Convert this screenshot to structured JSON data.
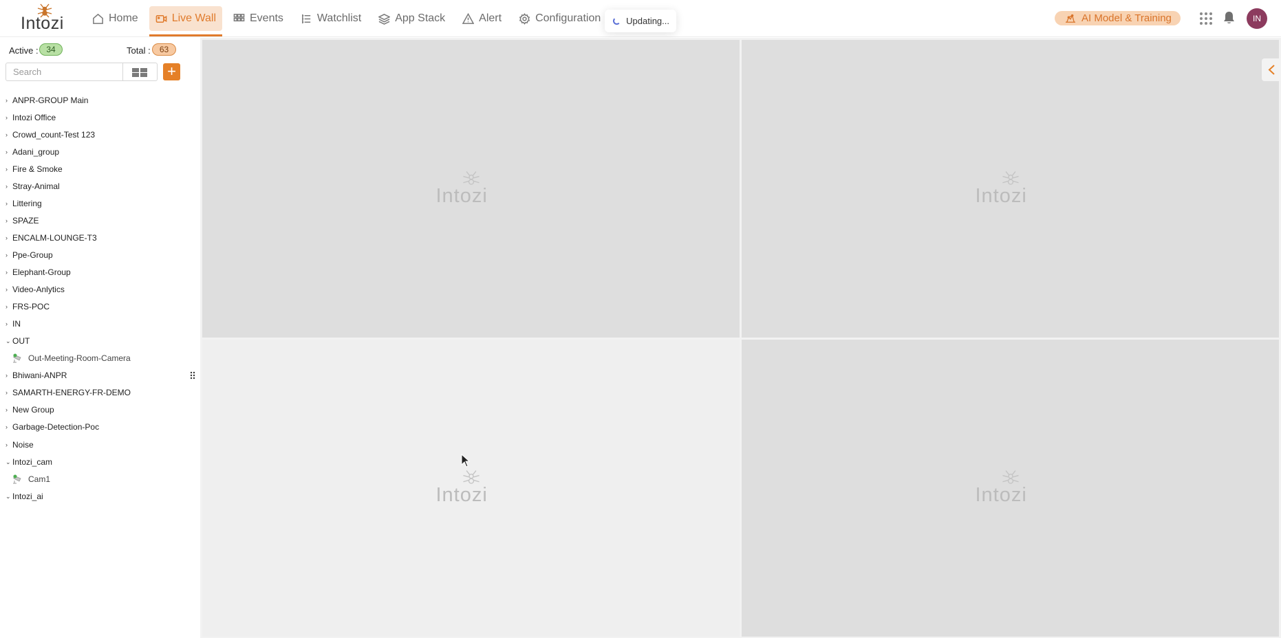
{
  "app": {
    "logo_text": "Intozi",
    "watermark_text": "Intozi"
  },
  "nav": {
    "items": [
      {
        "label": "Home",
        "icon": "home-icon",
        "active": false
      },
      {
        "label": "Live Wall",
        "icon": "video-icon",
        "active": true
      },
      {
        "label": "Events",
        "icon": "grid-icon",
        "active": false
      },
      {
        "label": "Watchlist",
        "icon": "list-icon",
        "active": false
      },
      {
        "label": "App Stack",
        "icon": "layers-icon",
        "active": false
      },
      {
        "label": "Alert",
        "icon": "warning-icon",
        "active": false
      },
      {
        "label": "Configuration",
        "icon": "gear-icon",
        "active": false
      }
    ],
    "status_toast": "Updating...",
    "ai_button": "AI Model & Training",
    "avatar_initials": "IN"
  },
  "sidebar": {
    "active_label": "Active :",
    "active_count": "34",
    "total_label": "Total :",
    "total_count": "63",
    "search_placeholder": "Search",
    "tree": [
      {
        "label": "ANPR-GROUP Main",
        "expanded": false
      },
      {
        "label": "Intozi Office",
        "expanded": false
      },
      {
        "label": "Crowd_count-Test 123",
        "expanded": false
      },
      {
        "label": "Adani_group",
        "expanded": false
      },
      {
        "label": "Fire & Smoke",
        "expanded": false
      },
      {
        "label": "Stray-Animal",
        "expanded": false
      },
      {
        "label": "Littering",
        "expanded": false
      },
      {
        "label": "SPAZE",
        "expanded": false
      },
      {
        "label": "ENCALM-LOUNGE-T3",
        "expanded": false
      },
      {
        "label": "Ppe-Group",
        "expanded": false
      },
      {
        "label": "Elephant-Group",
        "expanded": false
      },
      {
        "label": "Video-Anlytics",
        "expanded": false
      },
      {
        "label": "FRS-POC",
        "expanded": false
      },
      {
        "label": "IN",
        "expanded": false
      },
      {
        "label": "OUT",
        "expanded": true,
        "cameras": [
          "Out-Meeting-Room-Camera"
        ]
      },
      {
        "label": "Bhiwani-ANPR",
        "expanded": false
      },
      {
        "label": "SAMARTH-ENERGY-FR-DEMO",
        "expanded": false
      },
      {
        "label": "New Group",
        "expanded": false
      },
      {
        "label": "Garbage-Detection-Poc",
        "expanded": false
      },
      {
        "label": "Noise",
        "expanded": false
      },
      {
        "label": "Intozi_cam",
        "expanded": true,
        "cameras": [
          "Cam1"
        ]
      },
      {
        "label": "Intozi_ai",
        "expanded": true
      }
    ]
  },
  "colors": {
    "accent": "#e58027",
    "active_badge": "#b8e0a4",
    "total_badge": "#f7c9a1",
    "avatar": "#8c3b5e"
  }
}
